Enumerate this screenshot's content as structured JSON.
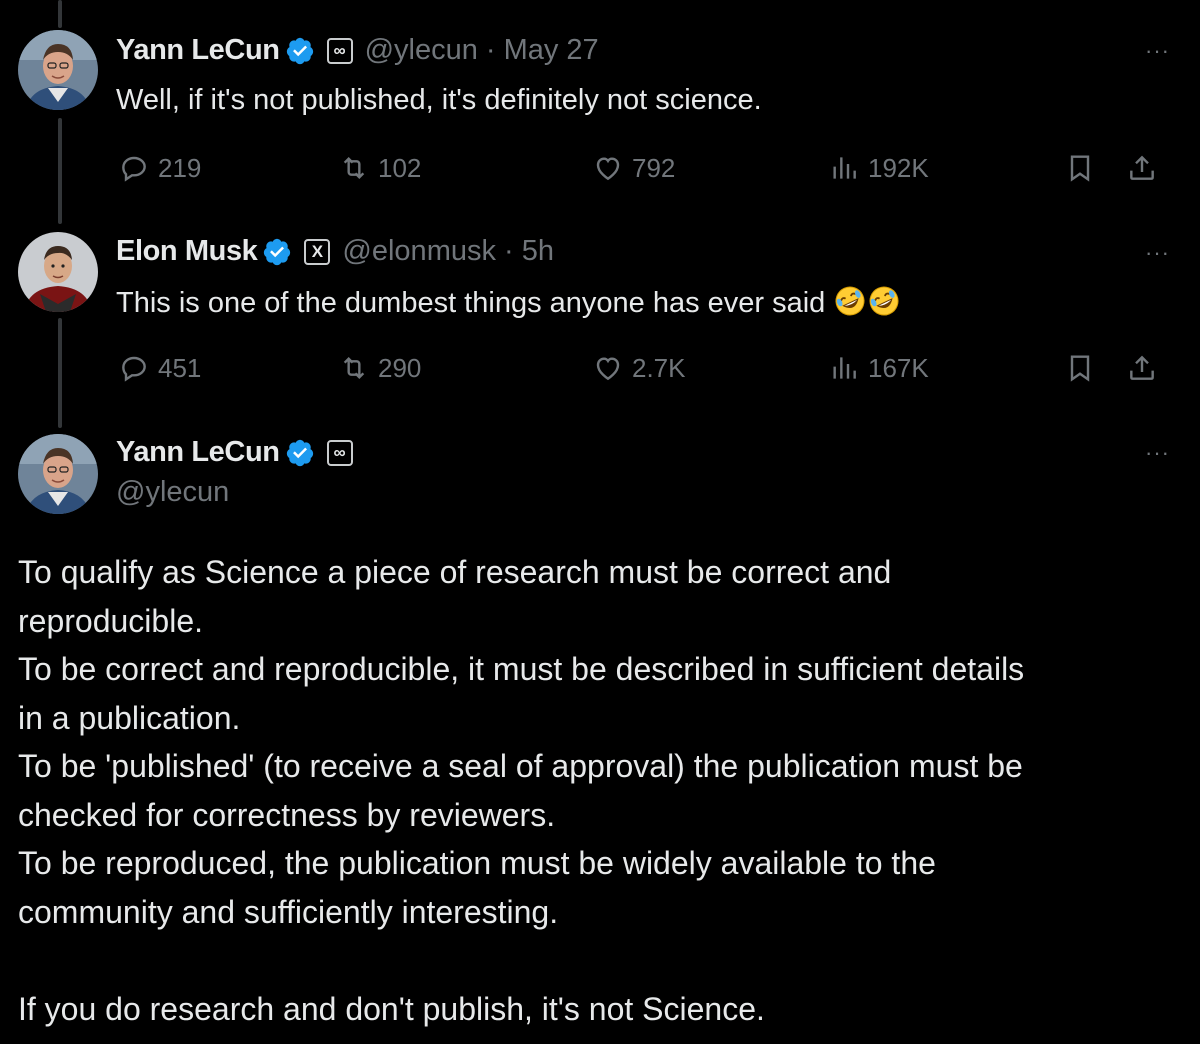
{
  "tweets": [
    {
      "name": "Yann LeCun",
      "handle": "@ylecun",
      "date": "· May 27",
      "affiliation_label": "∞",
      "text": "Well, if it's not published, it's definitely not science.",
      "stats": {
        "replies": "219",
        "reposts": "102",
        "likes": "792",
        "views": "192K"
      }
    },
    {
      "name": "Elon Musk",
      "handle": "@elonmusk",
      "date": "· 5h",
      "affiliation_label": "X",
      "text": "This is one of the dumbest things anyone has ever said",
      "emojis": [
        "rolling-on-floor-laughing",
        "rolling-on-floor-laughing"
      ],
      "stats": {
        "replies": "451",
        "reposts": "290",
        "likes": "2.7K",
        "views": "167K"
      }
    }
  ],
  "main_tweet": {
    "name": "Yann LeCun",
    "handle": "@ylecun",
    "affiliation_label": "∞",
    "lines": [
      "To qualify as Science a piece of research must be correct and",
      "reproducible.",
      "To be correct and reproducible, it must be described in sufficient details",
      "in a publication.",
      "To be 'published' (to receive a seal of approval) the publication must be",
      "checked for correctness by reviewers.",
      "To be reproduced, the publication must be widely available to the",
      "community and sufficiently interesting."
    ],
    "final_line": "If you do research and don't publish, it's not Science."
  },
  "more_label": "···",
  "colors": {
    "background": "#000000",
    "text": "#e7e9ea",
    "muted": "#71767b",
    "verified": "#1d9bf0"
  }
}
